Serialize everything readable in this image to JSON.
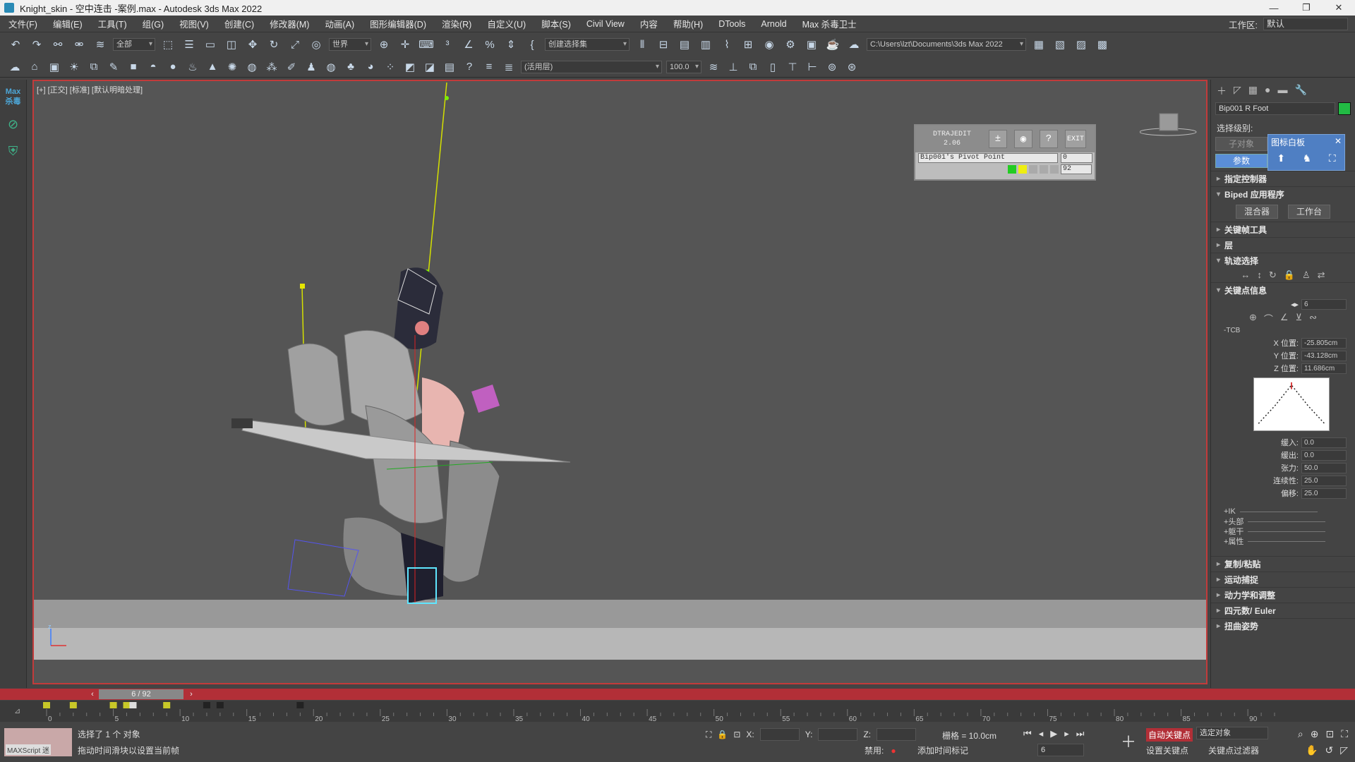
{
  "app": {
    "title": "Knight_skin - 空中连击 -案例.max - Autodesk 3ds Max 2022",
    "win_min": "—",
    "win_max": "❐",
    "win_close": "✕"
  },
  "menu": [
    "文件(F)",
    "编辑(E)",
    "工具(T)",
    "组(G)",
    "视图(V)",
    "创建(C)",
    "修改器(M)",
    "动画(A)",
    "图形编辑器(D)",
    "渲染(R)",
    "自定义(U)",
    "脚本(S)",
    "Civil View",
    "内容",
    "帮助(H)",
    "DTools",
    "Arnold",
    "Max 杀毒卫士"
  ],
  "workspace": {
    "label": "工作区:",
    "value": "默认"
  },
  "toolbar": {
    "filter": "全部",
    "coord": "世界",
    "selset": "创建选择集",
    "path": "C:\\Users\\lzt\\Documents\\3ds Max 2022",
    "layer": "(活用层)",
    "zoom_val": "100.0"
  },
  "leftbar": {
    "logo_line1": "Max",
    "logo_line2": "杀毒"
  },
  "viewport": {
    "label": "[+] [正交] [标准] [默认明暗处理]",
    "axis_label": "z"
  },
  "dtrajedit": {
    "name_line1": "DTRAJEDIT",
    "name_line2": "2.06",
    "pivot_field": "Bip001's Pivot Point",
    "num1": "0",
    "num2": "92",
    "exit_label": "EXIT",
    "help_label": "?"
  },
  "cmdpanel": {
    "object_name": "Bip001 R Foot",
    "object_color": "#22bb44",
    "selection_level": "选择级别:",
    "sub_object": "子对象",
    "params": "参数",
    "popup_title": "图标白板",
    "rollouts_top": [
      "指定控制器",
      "Biped 应用程序"
    ],
    "mix_btn": "混合器",
    "workbench_btn": "工作台",
    "rollouts_mid": [
      "关键帧工具",
      "层",
      "轨迹选择"
    ],
    "keyinfo_title": "关键点信息",
    "key_number": "6",
    "tcb": "-TCB",
    "x_label": "X 位置:",
    "x_val": "-25.805cm",
    "y_label": "Y 位置:",
    "y_val": "-43.128cm",
    "z_label": "Z 位置:",
    "z_val": "11.686cm",
    "ease_in_label": "缓入:",
    "ease_in": "0.0",
    "ease_out_label": "缓出:",
    "ease_out": "0.0",
    "tension_label": "张力:",
    "tension": "50.0",
    "continuity_label": "连续性:",
    "continuity": "25.0",
    "bias_label": "偏移:",
    "bias": "25.0",
    "extras": [
      "+IK",
      "+头部",
      "+躯干",
      "+属性"
    ],
    "rollouts_bottom": [
      "复制/粘贴",
      "运动捕捉",
      "动力学和调整",
      "四元数/ Euler",
      "扭曲姿势"
    ]
  },
  "timeline": {
    "frame_display": "6 / 92",
    "current_frame": 6,
    "total_frames": 92,
    "ticks": [
      "0",
      "5",
      "10",
      "15",
      "20",
      "25",
      "30",
      "35",
      "40",
      "45",
      "50",
      "55",
      "60",
      "65",
      "70",
      "75",
      "80",
      "85",
      "90"
    ],
    "key_frames_yellow": [
      0,
      2,
      5,
      6,
      9
    ],
    "key_frames_dark": [
      12,
      13,
      19
    ]
  },
  "status": {
    "selected": "选择了 1 个 对象",
    "hint": "拖动时间滑块以设置当前帧",
    "maxscript": "MAXScript 迷",
    "x_label": "X:",
    "y_label": "Y:",
    "z_label": "Z:",
    "grid": "栅格 = 10.0cm",
    "autokey": "自动关键点",
    "setkey": "设置关键点",
    "selected_obj": "选定对象",
    "key_filters": "关键点过滤器",
    "disable": "禁用:",
    "add_time": "添加时间标记",
    "frame_field": "6"
  }
}
